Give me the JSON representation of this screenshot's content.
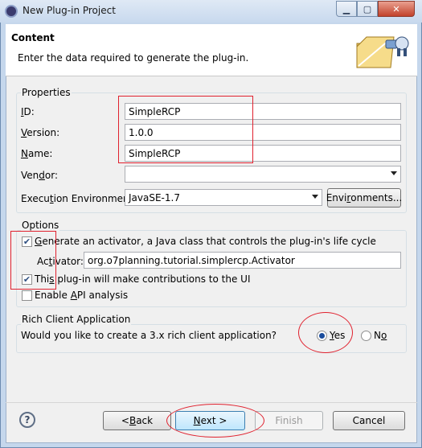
{
  "window": {
    "title": "New Plug-in Project"
  },
  "header": {
    "title": "Content",
    "description": "Enter the data required to generate the plug-in."
  },
  "properties": {
    "group_title": "Properties",
    "id_label_u": "I",
    "id_label_rest": "D:",
    "id_value": "SimpleRCP",
    "version_label_u": "V",
    "version_label_rest": "ersion:",
    "version_value": "1.0.0",
    "name_label_u": "N",
    "name_label_rest": "ame:",
    "name_value": "SimpleRCP",
    "vendor_label_pre": "Ven",
    "vendor_label_u": "d",
    "vendor_label_rest": "or:",
    "vendor_value": "",
    "env_label_pre": "Execu",
    "env_label_u": "t",
    "env_label_rest": "ion Environment:",
    "env_value": "JavaSE-1.7",
    "env_button_pre": "Envi",
    "env_button_u": "r",
    "env_button_rest": "onments..."
  },
  "options": {
    "group_title": "Options",
    "activator_check_u": "G",
    "activator_check_rest": "enerate an activator, a Java class that controls the plug-in's life cycle",
    "activator_checked": true,
    "activator_label_pre": "Ac",
    "activator_label_u": "t",
    "activator_label_rest": "ivator:",
    "activator_value": "org.o7planning.tutorial.simplercp.Activator",
    "ui_check_pre": "Thi",
    "ui_check_u": "s",
    "ui_check_rest": " plug-in will make contributions to the UI",
    "ui_checked": true,
    "api_check_pre": "Enable ",
    "api_check_u": "A",
    "api_check_rest": "PI analysis",
    "api_checked": false
  },
  "rcp": {
    "group_title": "Rich Client Application",
    "question": "Would you like to create a 3.x rich client application?",
    "yes_u": "Y",
    "yes_rest": "es",
    "no_pre": "N",
    "no_u": "o",
    "no_rest": "",
    "selected": "Yes"
  },
  "footer": {
    "help_icon": "?",
    "back_pre": "< ",
    "back_u": "B",
    "back_rest": "ack",
    "next_pre": "",
    "next_u": "N",
    "next_rest": "ext >",
    "finish_label": "Finish",
    "cancel_label": "Cancel"
  },
  "colors": {
    "annotation": "#e0212e",
    "title_bar": "#c8d9ee",
    "dialog_bg": "#f0f0f0"
  }
}
